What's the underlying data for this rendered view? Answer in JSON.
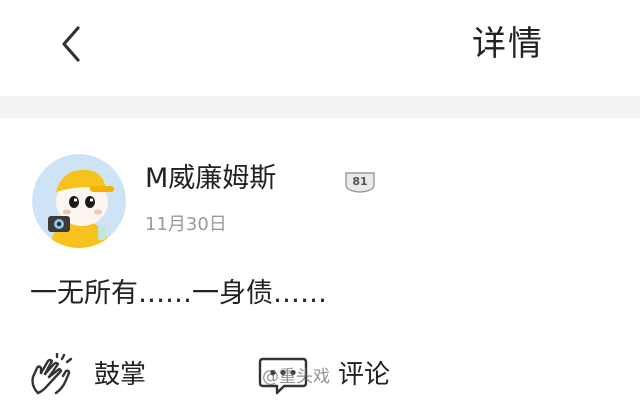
{
  "nav": {
    "title": "详情",
    "back_icon": "chevron-left-icon"
  },
  "post": {
    "author": {
      "name": "M威廉姆斯",
      "level": "81",
      "avatar_icon": "cartoon-baby-with-yellow-cap-and-camera"
    },
    "date": "11月30日",
    "content": "一无所有……一身债……"
  },
  "actions": {
    "clap_label": "鼓掌",
    "clap_icon": "clapping-hands-icon",
    "comment_label": "评论",
    "comment_icon": "comment-bubble-icon"
  },
  "watermark": "@重头戏",
  "colors": {
    "separator": "#f3f3f5",
    "text": "#222222",
    "secondary_text": "#9a9a9a",
    "avatar_bg": "#cfe3f7",
    "cap": "#f6c21b"
  }
}
